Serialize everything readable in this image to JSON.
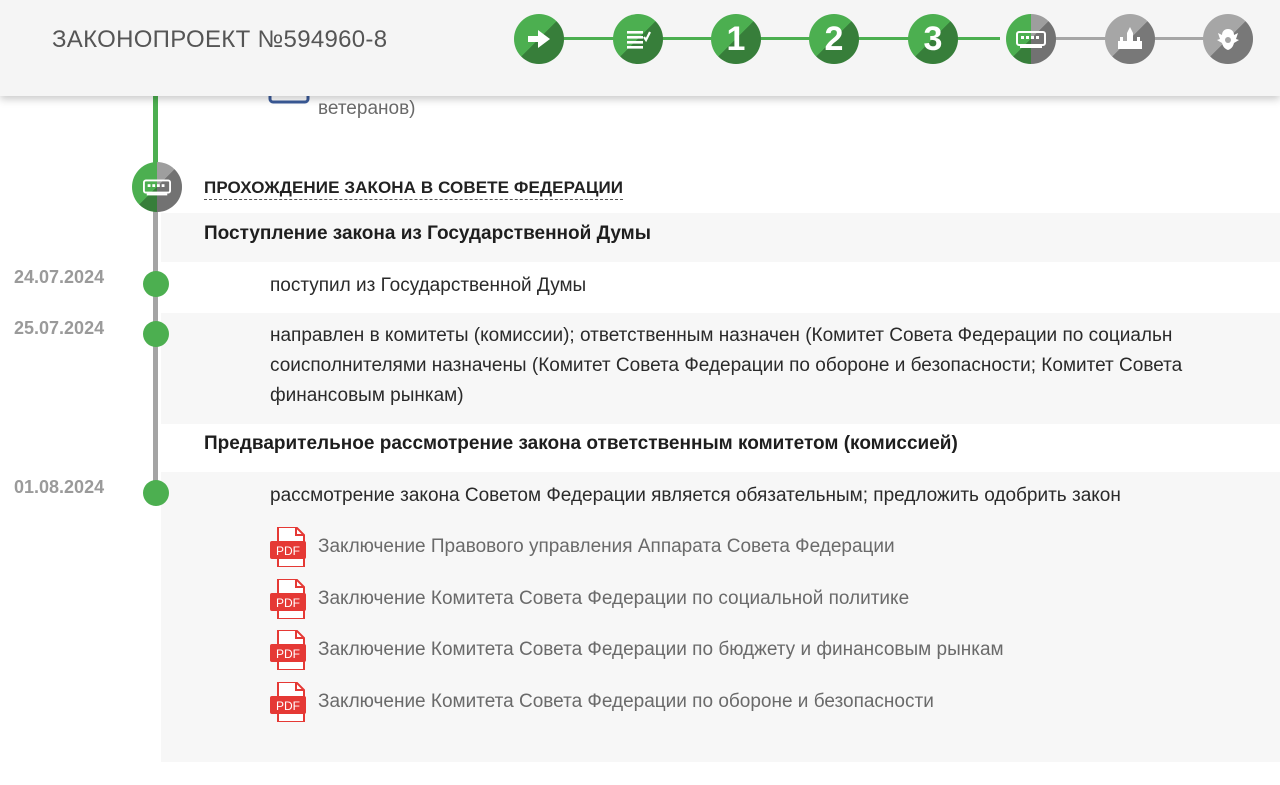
{
  "header": {
    "bill_title": "ЗАКОНОПРОЕКТ №594960-8",
    "stages": [
      {
        "kind": "icon",
        "icon": "arrow-right-icon",
        "state": "done"
      },
      {
        "kind": "icon",
        "icon": "document-list-icon",
        "state": "done"
      },
      {
        "kind": "number",
        "label": "1",
        "state": "done"
      },
      {
        "kind": "number",
        "label": "2",
        "state": "done"
      },
      {
        "kind": "number",
        "label": "3",
        "state": "done"
      },
      {
        "kind": "icon",
        "icon": "federation-council-icon",
        "state": "current"
      },
      {
        "kind": "icon",
        "icon": "kremlin-icon",
        "state": "pending"
      },
      {
        "kind": "icon",
        "icon": "state-emblem-icon",
        "state": "pending"
      }
    ]
  },
  "previous_fragment": "ветеранов)",
  "section": {
    "title": "ПРОХОЖДЕНИЕ ЗАКОНА В СОВЕТЕ ФЕДЕРАЦИИ",
    "groups": [
      {
        "title": "Поступление закона из Государственной Думы",
        "events": [
          {
            "date": "24.07.2024",
            "lines": [
              "поступил из Государственной Думы"
            ]
          },
          {
            "date": "25.07.2024",
            "lines": [
              "направлен в комитеты (комиссии); ответственным назначен (Комитет Совета Федерации по социальн",
              "соисполнителями назначены (Комитет Совета Федерации по обороне и безопасности; Комитет Совета",
              "финансовым рынкам)"
            ]
          }
        ]
      },
      {
        "title": "Предварительное рассмотрение закона ответственным комитетом (комиссией)",
        "events": [
          {
            "date": "01.08.2024",
            "lines": [
              "рассмотрение закона Советом Федерации является обязательным; предложить одобрить закон"
            ]
          }
        ],
        "documents": [
          {
            "icon": "pdf-icon",
            "label": "PDF",
            "title": "Заключение Правового управления Аппарата Совета Федерации"
          },
          {
            "icon": "pdf-icon",
            "label": "PDF",
            "title": "Заключение Комитета Совета Федерации по социальной политике"
          },
          {
            "icon": "pdf-icon",
            "label": "PDF",
            "title": "Заключение Комитета Совета Федерации по бюджету и финансовым рынкам"
          },
          {
            "icon": "pdf-icon",
            "label": "PDF",
            "title": "Заключение Комитета Совета Федерации по обороне и безопасности"
          }
        ]
      }
    ]
  },
  "colors": {
    "accent_green": "#4caf50",
    "pending_grey": "#a6a6a6",
    "pdf_red": "#e53935"
  }
}
